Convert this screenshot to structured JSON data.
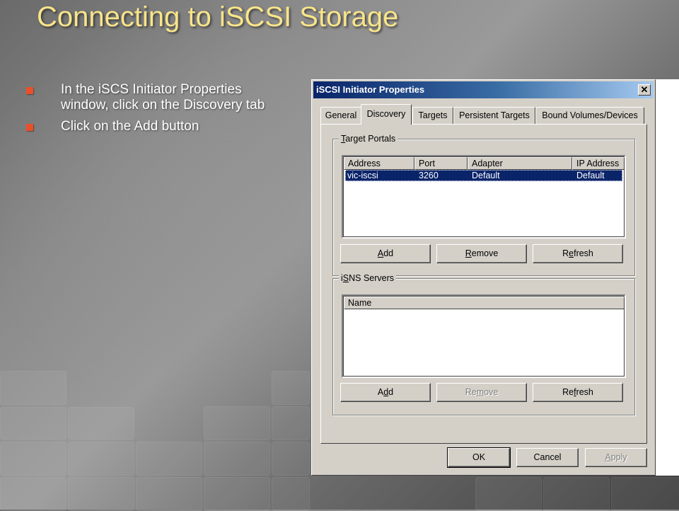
{
  "slide": {
    "title": "Connecting to iSCSI Storage",
    "bullets": [
      "In the iSCS Initiator Properties window, click on the Discovery tab",
      "Click on the Add button"
    ]
  },
  "dialog": {
    "title": "iSCSI Initiator Properties",
    "close_glyph": "✕",
    "tabs": [
      "General",
      "Discovery",
      "Targets",
      "Persistent Targets",
      "Bound Volumes/Devices"
    ],
    "active_tab": "Discovery",
    "target_portals": {
      "label_mnemonic": "T",
      "label_rest": "arget Portals",
      "columns": [
        "Address",
        "Port",
        "Adapter",
        "IP Address"
      ],
      "rows": [
        {
          "address": "vic-iscsi",
          "port": "3260",
          "adapter": "Default",
          "ip_address": "Default",
          "selected": true
        }
      ],
      "buttons": {
        "add": {
          "before": "",
          "mnemonic": "A",
          "after": "dd"
        },
        "remove": {
          "before": "",
          "mnemonic": "R",
          "after": "emove"
        },
        "refresh": {
          "before": "R",
          "mnemonic": "e",
          "after": "fresh"
        }
      }
    },
    "isns_servers": {
      "label_before": "i",
      "label_mnemonic": "S",
      "label_rest": "NS Servers",
      "columns": [
        "Name"
      ],
      "rows": [],
      "buttons": {
        "add": {
          "before": "A",
          "mnemonic": "d",
          "after": "d"
        },
        "remove": {
          "before": "Re",
          "mnemonic": "m",
          "after": "ove",
          "disabled": true
        },
        "refresh": {
          "before": "Re",
          "mnemonic": "f",
          "after": "resh"
        }
      }
    },
    "footer": {
      "ok": "OK",
      "cancel": "Cancel",
      "apply_mnemonic": "A",
      "apply_rest": "pply",
      "apply_disabled": true
    }
  },
  "colors": {
    "title": "#f8e48a",
    "bullet_marker": "#e8502a",
    "dialog_face": "#d4d0c8",
    "selection": "#0a246a"
  }
}
